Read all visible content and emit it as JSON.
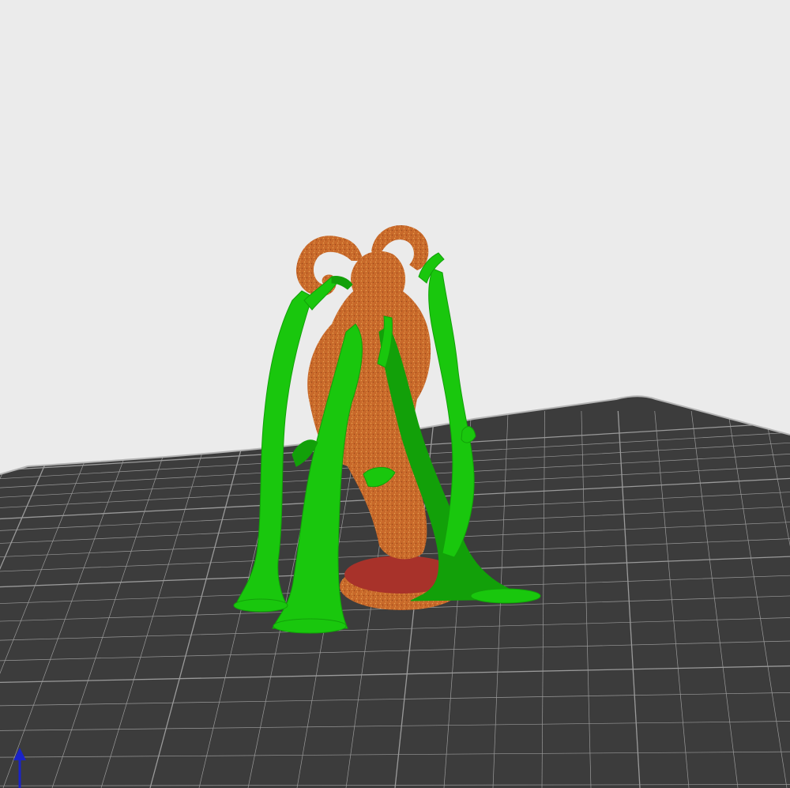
{
  "viewport": {
    "background_color": "#ebebeb",
    "view": "3d-perspective"
  },
  "build_plate": {
    "color": "#3c3c3c",
    "grid_line_color": "#9a9a9a",
    "edge_color": "#b4b4b4",
    "grid": "on"
  },
  "model": {
    "colors": {
      "body": "#c8692a",
      "body_speckle": "#e08a3c",
      "base_top": "#a8322a",
      "base_side": "#c25a2a",
      "supports": "#19c70d",
      "supports_shade": "#12a009"
    },
    "support_type": "tree"
  },
  "axis_indicator": {
    "color": "#1a23c8",
    "icon": "z-axis-arrow-icon"
  }
}
